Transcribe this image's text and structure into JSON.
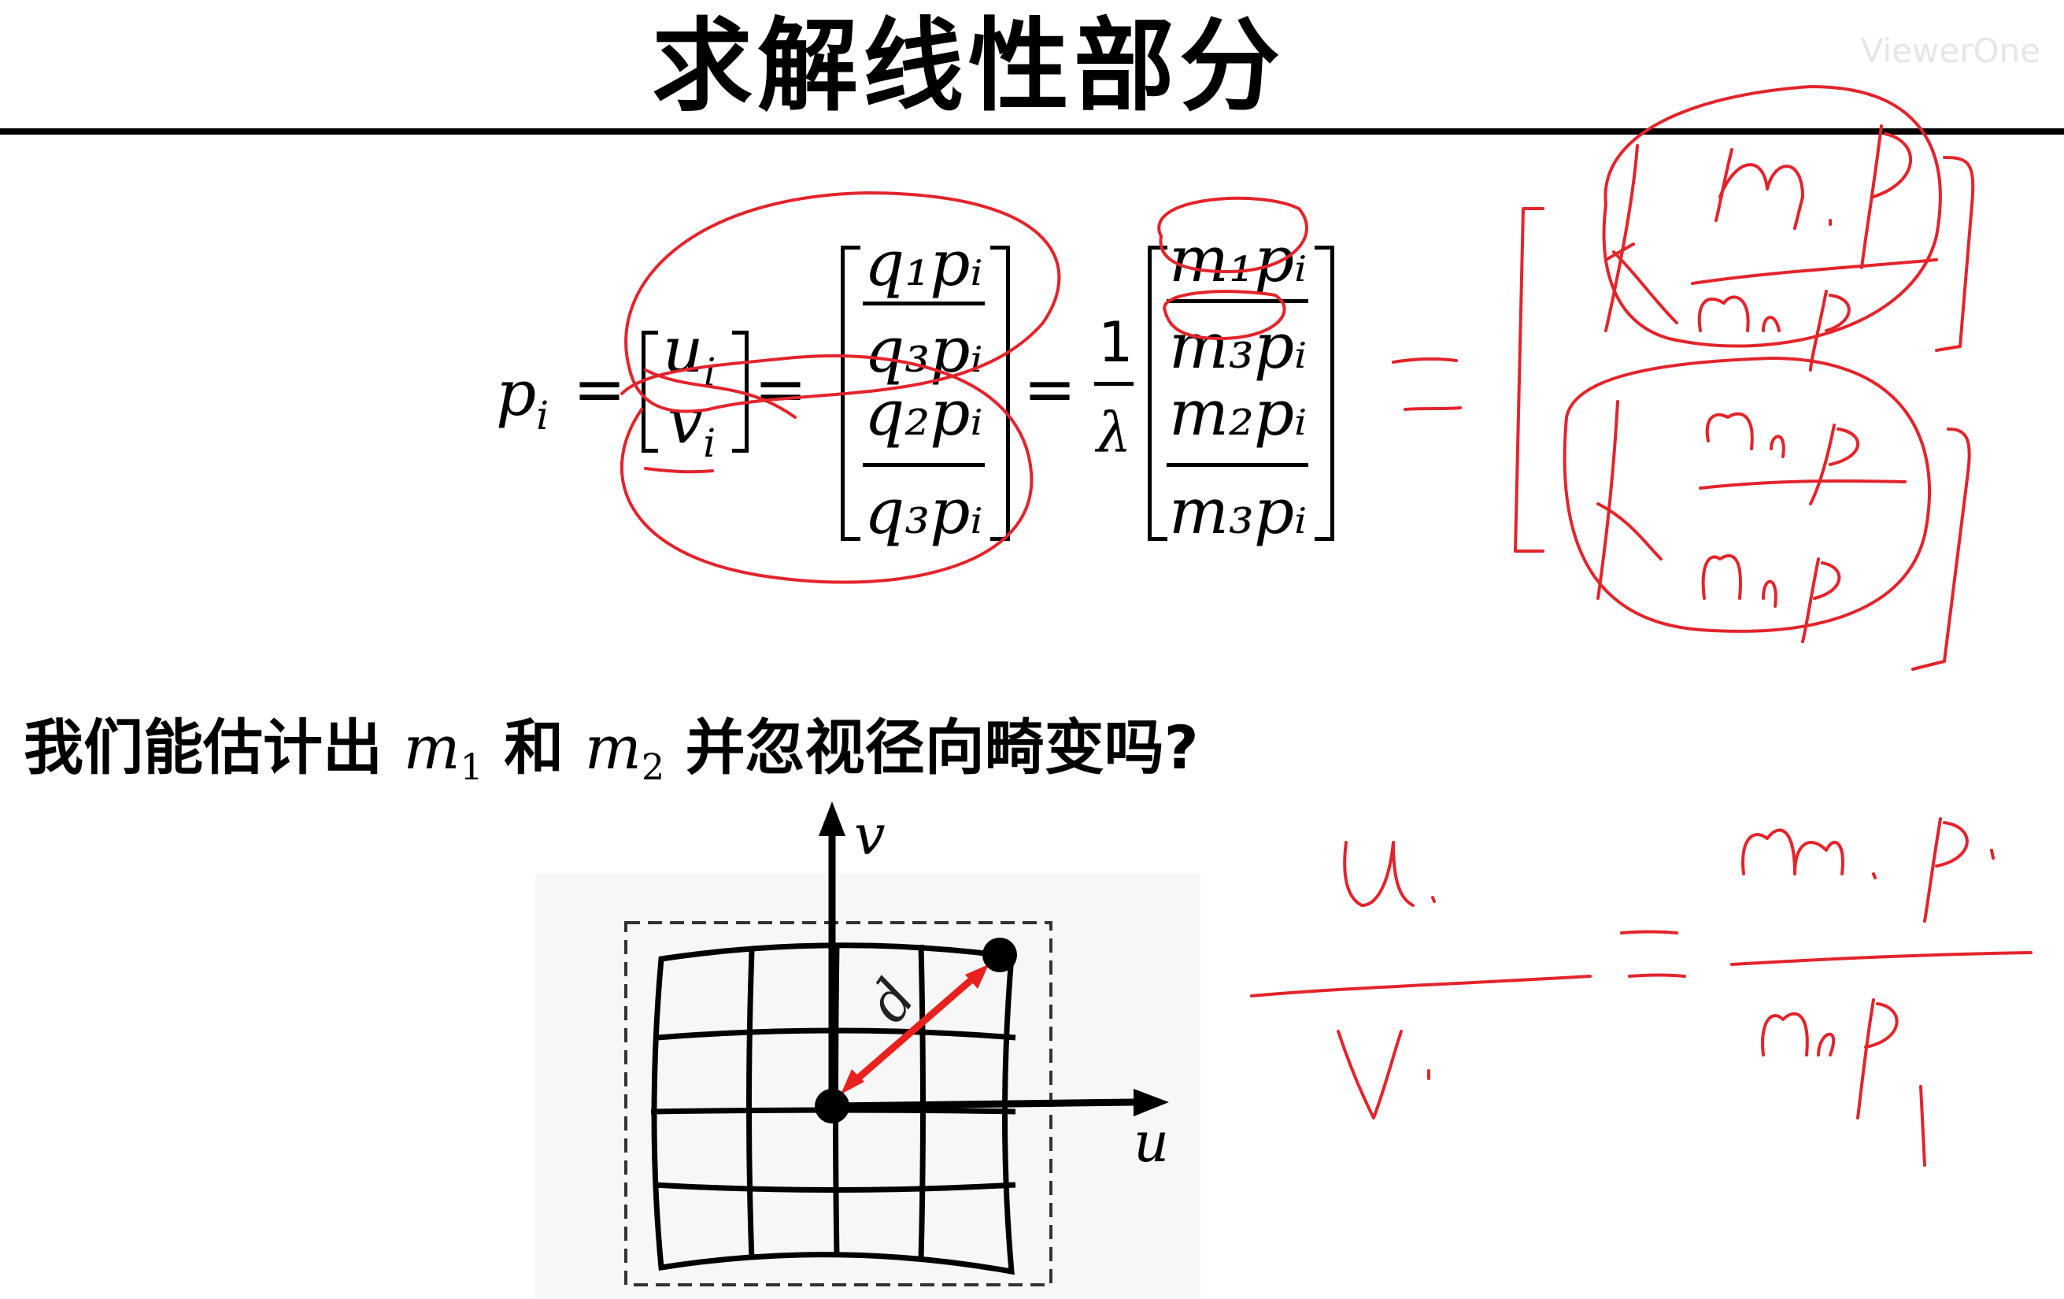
{
  "slide": {
    "title": "求解线性部分",
    "watermark": "ViewerOne"
  },
  "equation": {
    "lhs": "p",
    "lhs_sub": "i",
    "eq1": "=",
    "vec": [
      "u",
      "v"
    ],
    "vec_sub": "i",
    "eq2": "=",
    "frac_a_top": "q₁pᵢ",
    "frac_a_bot": "q₃pᵢ",
    "frac_b_top": "q₂pᵢ",
    "frac_b_bot": "q₃pᵢ",
    "eq3": "=",
    "scalar_num": "1",
    "scalar_den": "λ",
    "frac_c_top": "m₁pᵢ",
    "frac_c_bot": "m₃pᵢ",
    "frac_d_top": "m₂pᵢ",
    "frac_d_bot": "m₃pᵢ"
  },
  "question": {
    "part1": "我们能估计出 ",
    "m1": "m",
    "m1_sub": "1",
    "part2": " 和 ",
    "m2": "m",
    "m2_sub": "2",
    "part3": " 并忽视径向畸变吗?"
  },
  "figure": {
    "axis_v": "v",
    "axis_u": "u",
    "distance_label": "d"
  },
  "colors": {
    "ink_red": "#e3242b",
    "text": "#000000",
    "arrow_red": "#e8211f"
  }
}
